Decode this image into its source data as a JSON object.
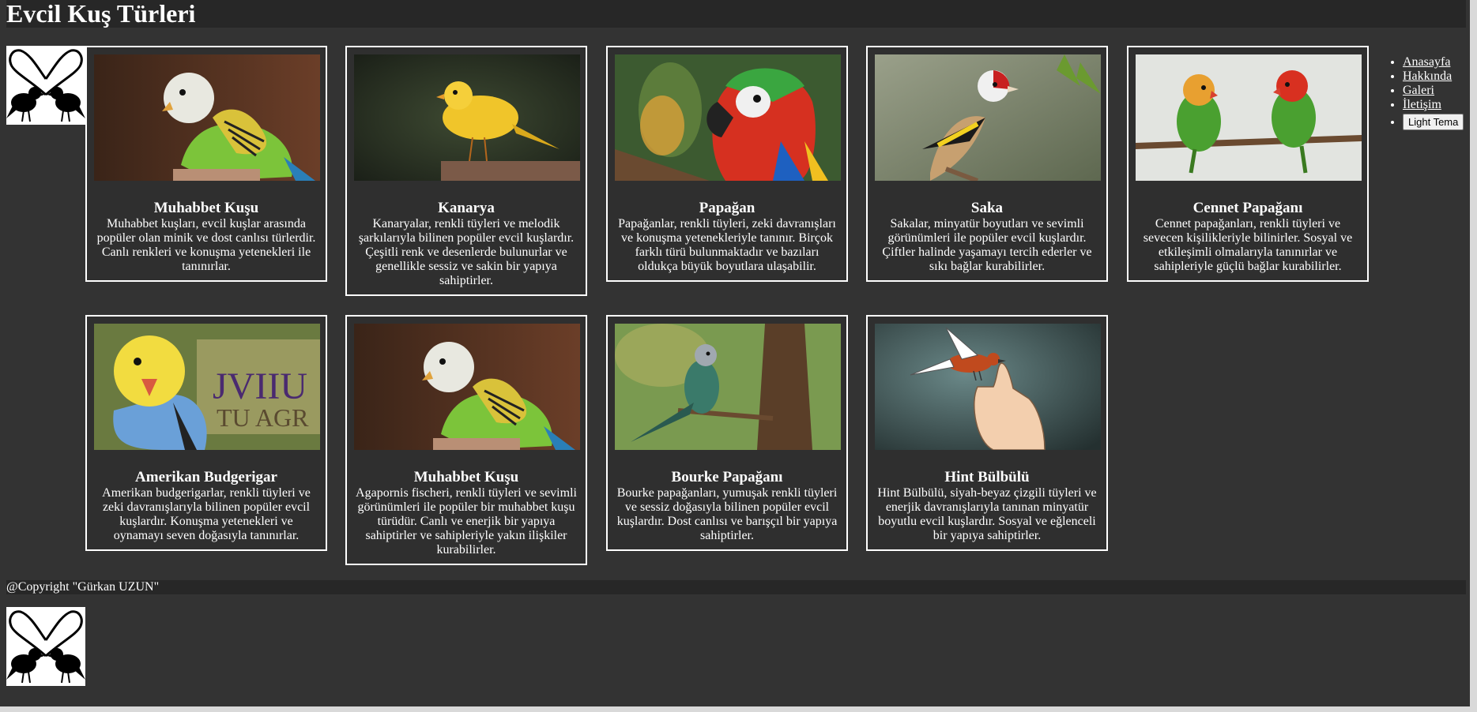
{
  "header": {
    "title": "Evcil Kuş Türleri"
  },
  "nav": {
    "items": [
      "Anasayfa",
      "Hakkında",
      "Galeri",
      "İletişim"
    ],
    "theme_button": "Light Tema"
  },
  "cards": [
    {
      "title": "Muhabbet Kuşu",
      "text": "Muhabbet kuşları, evcil kuşlar arasında popüler olan minik ve dost canlısı türlerdir. Canlı renkleri ve konuşma yetenekleri ile tanınırlar.",
      "image_icon": "budgerigar-photo"
    },
    {
      "title": "Kanarya",
      "text": "Kanaryalar, renkli tüyleri ve melodik şarkılarıyla bilinen popüler evcil kuşlardır. Çeşitli renk ve desenlerde bulunurlar ve genellikle sessiz ve sakin bir yapıya sahiptirler.",
      "image_icon": "canary-photo"
    },
    {
      "title": "Papağan",
      "text": "Papağanlar, renkli tüyleri, zeki davranışları ve konuşma yetenekleriyle tanınır. Birçok farklı türü bulunmaktadır ve bazıları oldukça büyük boyutlara ulaşabilir.",
      "image_icon": "parrot-photo"
    },
    {
      "title": "Saka",
      "text": "Sakalar, minyatür boyutları ve sevimli görünümleri ile popüler evcil kuşlardır. Çiftler halinde yaşamayı tercih ederler ve sıkı bağlar kurabilirler.",
      "image_icon": "goldfinch-photo"
    },
    {
      "title": "Cennet Papağanı",
      "text": "Cennet papağanları, renkli tüyleri ve sevecen kişilikleriyle bilinirler. Sosyal ve etkileşimli olmalarıyla tanınırlar ve sahipleriyle güçlü bağlar kurabilirler.",
      "image_icon": "lovebirds-photo"
    },
    {
      "title": "Amerikan Budgerigar",
      "text": "Amerikan budgerigarlar, renkli tüyleri ve zeki davranışlarıyla bilinen popüler evcil kuşlardır. Konuşma yetenekleri ve oynamayı seven doğasıyla tanınırlar.",
      "image_icon": "budgerigar-yellow-photo"
    },
    {
      "title": "Muhabbet Kuşu",
      "text": "Agapornis fischeri, renkli tüyleri ve sevimli görünümleri ile popüler bir muhabbet kuşu türüdür. Canlı ve enerjik bir yapıya sahiptirler ve sahipleriyle yakın ilişkiler kurabilirler.",
      "image_icon": "budgerigar-photo"
    },
    {
      "title": "Bourke Papağanı",
      "text": "Bourke papağanları, yumuşak renkli tüyleri ve sessiz doğasıyla bilinen popüler evcil kuşlardır. Dost canlısı ve barışçıl bir yapıya sahiptirler.",
      "image_icon": "bourke-parrot-photo"
    },
    {
      "title": "Hint Bülbülü",
      "text": "Hint Bülbülü, siyah-beyaz çizgili tüyleri ve enerjik davranışlarıyla tanınan minyatür boyutlu evcil kuşlardır. Sosyal ve eğlenceli bir yapıya sahiptirler.",
      "image_icon": "bird-on-hand-illustration"
    }
  ],
  "sign_text": [
    "JVIIU",
    "TU AGR"
  ],
  "footer": {
    "copyright": "@Copyright \"Gürkan UZUN\""
  },
  "colors": {
    "background": "#333333",
    "bar": "#272727",
    "card_border": "#ffffff"
  },
  "icons": {
    "logo": "lovebirds-heart-logo"
  }
}
